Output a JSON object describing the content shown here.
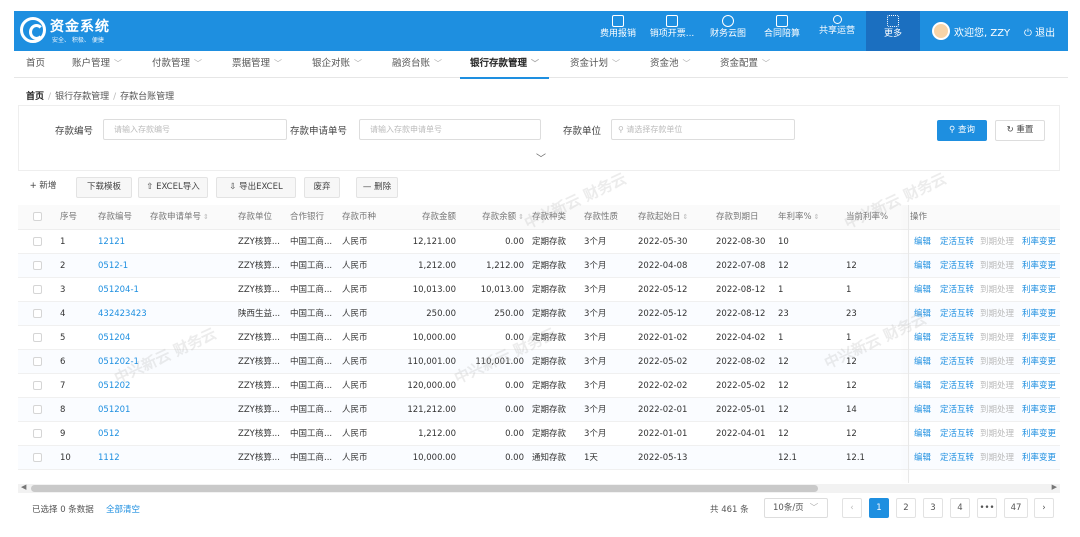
{
  "app": {
    "title": "资金系统",
    "subtitle": "安全、 积极、 便捷"
  },
  "top_menu": [
    {
      "label": "费用报销",
      "icon": "receipt-icon"
    },
    {
      "label": "销项开票...",
      "icon": "invoice-icon"
    },
    {
      "label": "财务云图",
      "icon": "cloud-chart-icon"
    },
    {
      "label": "合同陪算",
      "icon": "contract-icon"
    },
    {
      "label": "共享运营",
      "icon": "share-icon"
    },
    {
      "label": "更多",
      "icon": "grid-icon"
    }
  ],
  "user": {
    "greeting": "欢迎您, ZZY",
    "logout": "退出"
  },
  "nav": [
    {
      "label": "首页",
      "arrow": false
    },
    {
      "label": "账户管理",
      "arrow": true
    },
    {
      "label": "付款管理",
      "arrow": true
    },
    {
      "label": "票据管理",
      "arrow": true
    },
    {
      "label": "银企对账",
      "arrow": true
    },
    {
      "label": "融资台账",
      "arrow": true
    },
    {
      "label": "银行存款管理",
      "arrow": true
    },
    {
      "label": "资金计划",
      "arrow": true
    },
    {
      "label": "资金池",
      "arrow": true
    },
    {
      "label": "资金配置",
      "arrow": true
    }
  ],
  "breadcrumb": {
    "home": "首页",
    "level1": "银行存款管理",
    "level2": "存款台账管理"
  },
  "filters": {
    "deposit_no": {
      "label": "存款编号",
      "placeholder": "请输入存款编号"
    },
    "apply_no": {
      "label": "存款申请单号",
      "placeholder": "请输入存款申请单号"
    },
    "unit": {
      "label": "存款单位",
      "placeholder": "请选择存款单位"
    },
    "search": "查询",
    "reset": "重置"
  },
  "toolbar": {
    "add": "+ 新增",
    "template": "下载模板",
    "import": "EXCEL导入",
    "export": "导出EXCEL",
    "discard": "废弃",
    "delete": "删除"
  },
  "table": {
    "headers": [
      "序号",
      "存款编号",
      "存款申请单号",
      "存款单位",
      "合作银行",
      "存款币种",
      "存款金额",
      "存款余额",
      "存款种类",
      "存款性质",
      "存款起始日",
      "存款到期日",
      "年利率%",
      "当前利率%",
      "操作"
    ],
    "actions": {
      "edit": "编辑",
      "transfer": "定活互转",
      "expire": "到期处理",
      "rate": "利率变更"
    },
    "rows": [
      {
        "no": "1",
        "code": "12121",
        "unit": "ZZY核算...",
        "bank": "中国工商...",
        "currency": "人民币",
        "amount": "12,121.00",
        "balance": "0.00",
        "kind": "定期存款",
        "term": "3个月",
        "start": "2022-05-30",
        "end": "2022-08-30",
        "rate": "10",
        "cur_rate": ""
      },
      {
        "no": "2",
        "code": "0512-1",
        "unit": "ZZY核算...",
        "bank": "中国工商...",
        "currency": "人民币",
        "amount": "1,212.00",
        "balance": "1,212.00",
        "kind": "定期存款",
        "term": "3个月",
        "start": "2022-04-08",
        "end": "2022-07-08",
        "rate": "12",
        "cur_rate": "12"
      },
      {
        "no": "3",
        "code": "051204-1",
        "unit": "ZZY核算...",
        "bank": "中国工商...",
        "currency": "人民币",
        "amount": "10,013.00",
        "balance": "10,013.00",
        "kind": "定期存款",
        "term": "3个月",
        "start": "2022-05-12",
        "end": "2022-08-12",
        "rate": "1",
        "cur_rate": "1"
      },
      {
        "no": "4",
        "code": "432423423",
        "unit": "陕西生益...",
        "bank": "中国工商...",
        "currency": "人民币",
        "amount": "250.00",
        "balance": "250.00",
        "kind": "定期存款",
        "term": "3个月",
        "start": "2022-05-12",
        "end": "2022-08-12",
        "rate": "23",
        "cur_rate": "23"
      },
      {
        "no": "5",
        "code": "051204",
        "unit": "ZZY核算...",
        "bank": "中国工商...",
        "currency": "人民币",
        "amount": "10,000.00",
        "balance": "0.00",
        "kind": "定期存款",
        "term": "3个月",
        "start": "2022-01-02",
        "end": "2022-04-02",
        "rate": "1",
        "cur_rate": "1"
      },
      {
        "no": "6",
        "code": "051202-1",
        "unit": "ZZY核算...",
        "bank": "中国工商...",
        "currency": "人民币",
        "amount": "110,001.00",
        "balance": "110,001.00",
        "kind": "定期存款",
        "term": "3个月",
        "start": "2022-05-02",
        "end": "2022-08-02",
        "rate": "12",
        "cur_rate": "12"
      },
      {
        "no": "7",
        "code": "051202",
        "unit": "ZZY核算...",
        "bank": "中国工商...",
        "currency": "人民币",
        "amount": "120,000.00",
        "balance": "0.00",
        "kind": "定期存款",
        "term": "3个月",
        "start": "2022-02-02",
        "end": "2022-05-02",
        "rate": "12",
        "cur_rate": "12"
      },
      {
        "no": "8",
        "code": "051201",
        "unit": "ZZY核算...",
        "bank": "中国工商...",
        "currency": "人民币",
        "amount": "121,212.00",
        "balance": "0.00",
        "kind": "定期存款",
        "term": "3个月",
        "start": "2022-02-01",
        "end": "2022-05-01",
        "rate": "12",
        "cur_rate": "14"
      },
      {
        "no": "9",
        "code": "0512",
        "unit": "ZZY核算...",
        "bank": "中国工商...",
        "currency": "人民币",
        "amount": "1,212.00",
        "balance": "0.00",
        "kind": "定期存款",
        "term": "3个月",
        "start": "2022-01-01",
        "end": "2022-04-01",
        "rate": "12",
        "cur_rate": "12"
      },
      {
        "no": "10",
        "code": "1112",
        "unit": "ZZY核算...",
        "bank": "中国工商...",
        "currency": "人民币",
        "amount": "10,000.00",
        "balance": "0.00",
        "kind": "通知存款",
        "term": "1天",
        "start": "2022-05-13",
        "end": "",
        "rate": "12.1",
        "cur_rate": "12.1"
      }
    ]
  },
  "footer": {
    "selected": "已选择 0 条数据",
    "clear": "全部清空",
    "total": "共 461 条",
    "page_size": "10条/页",
    "pages": [
      "1",
      "2",
      "3",
      "4",
      "•••",
      "47"
    ],
    "prev": "‹",
    "next": "›"
  },
  "watermark": "中兴新云 财务云",
  "colors": {
    "brand": "#1e8fe0",
    "link": "#1e8fe0"
  }
}
